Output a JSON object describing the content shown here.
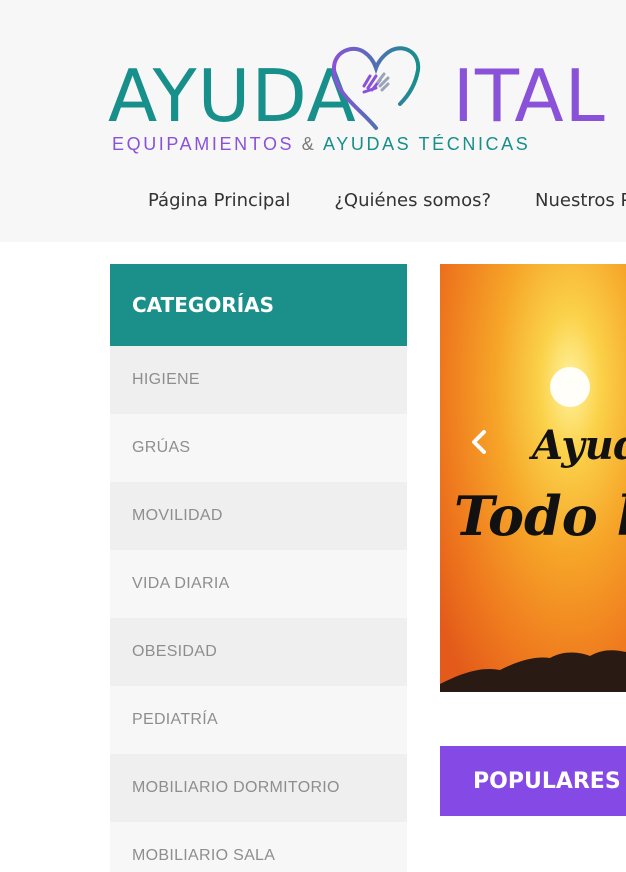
{
  "brand": {
    "name_part1": "AYUDA",
    "name_part2": "ITAL",
    "tagline_part1": "EQUIPAMIENTOS",
    "tagline_amp": "&",
    "tagline_part2": "AYUDAS TÉCNICAS",
    "color_teal": "#178f8b",
    "color_purple": "#8a52d9"
  },
  "nav": {
    "items": [
      {
        "label": "Página Principal"
      },
      {
        "label": "¿Quiénes somos?"
      },
      {
        "label": "Nuestros Pro"
      }
    ]
  },
  "sidebar": {
    "title": "CATEGORÍAS",
    "items": [
      {
        "label": "HIGIENE"
      },
      {
        "label": "GRÚAS"
      },
      {
        "label": "MOVILIDAD"
      },
      {
        "label": "VIDA DIARIA"
      },
      {
        "label": "OBESIDAD"
      },
      {
        "label": "PEDIATRÍA"
      },
      {
        "label": "MOBILIARIO DORMITORIO"
      },
      {
        "label": "MOBILIARIO SALA"
      }
    ]
  },
  "slider": {
    "line1": "Ayuda",
    "line2": "Todo lo",
    "prev_icon": "chevron-left-icon"
  },
  "popular": {
    "title": "POPULARES",
    "color": "#8549e6"
  }
}
